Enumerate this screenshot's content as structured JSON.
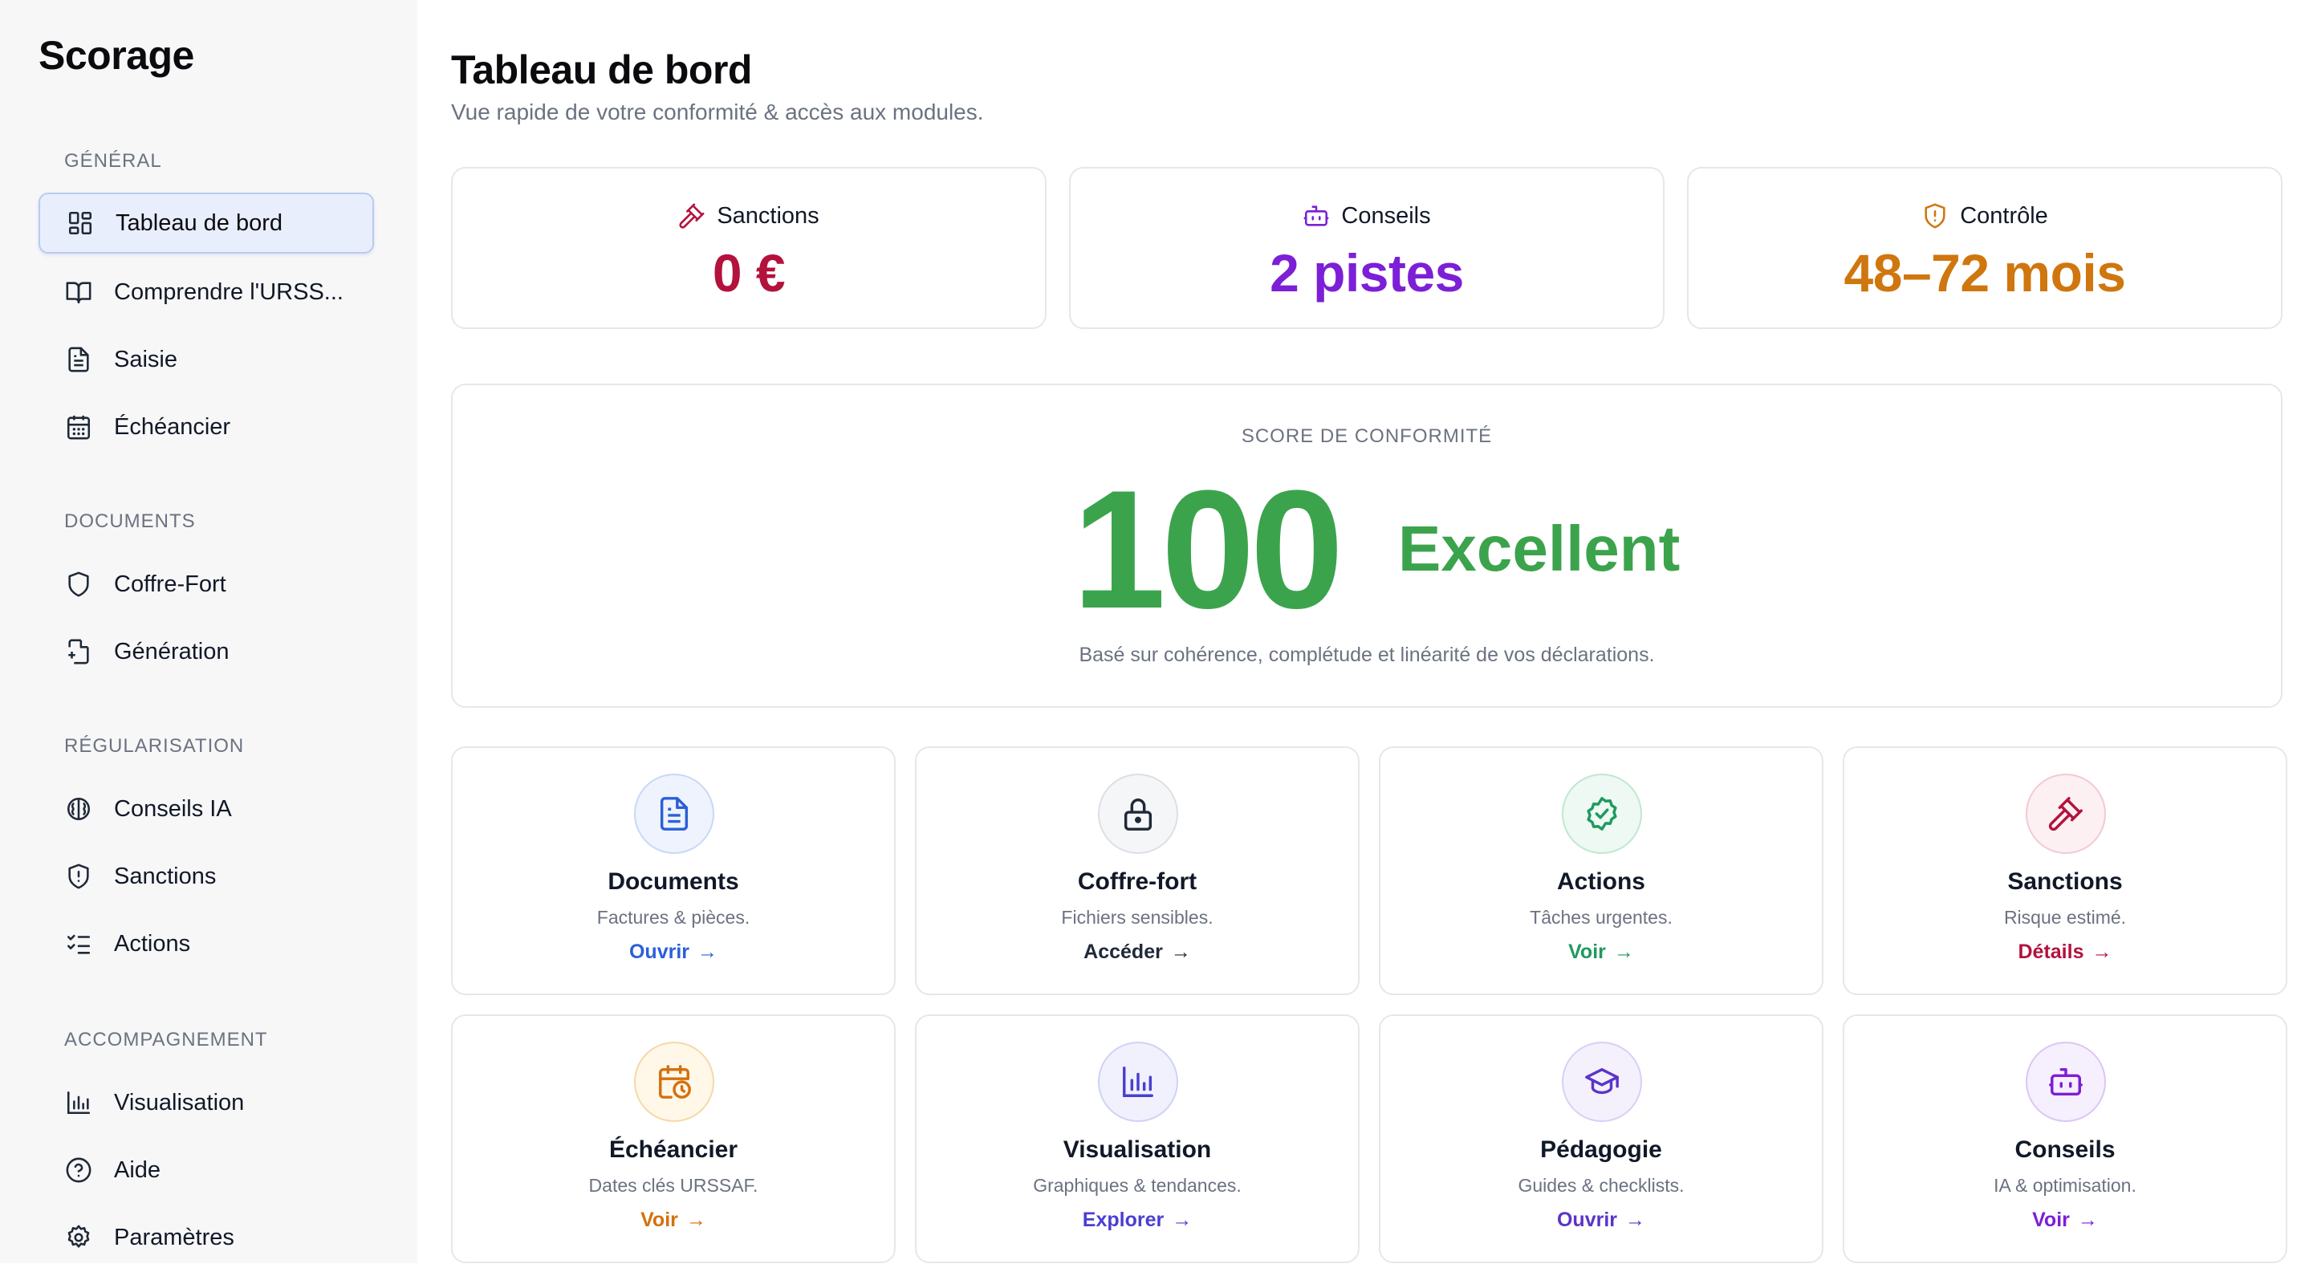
{
  "app": {
    "brand": "Scorage"
  },
  "sidebar": {
    "sections": [
      {
        "label": "GÉNÉRAL",
        "items": [
          {
            "label": "Tableau de bord",
            "icon": "dashboard-grid-icon",
            "active": true
          },
          {
            "label": "Comprendre l'URSS...",
            "icon": "book-icon"
          },
          {
            "label": "Saisie",
            "icon": "document-icon"
          },
          {
            "label": "Échéancier",
            "icon": "calendar-icon"
          }
        ]
      },
      {
        "label": "DOCUMENTS",
        "items": [
          {
            "label": "Coffre-Fort",
            "icon": "shield-icon"
          },
          {
            "label": "Génération",
            "icon": "file-plus-icon"
          }
        ]
      },
      {
        "label": "RÉGULARISATION",
        "items": [
          {
            "label": "Conseils IA",
            "icon": "brain-icon"
          },
          {
            "label": "Sanctions",
            "icon": "shield-alert-icon"
          },
          {
            "label": "Actions",
            "icon": "checklist-icon"
          }
        ]
      },
      {
        "label": "ACCOMPAGNEMENT",
        "items": [
          {
            "label": "Visualisation",
            "icon": "bar-chart-icon"
          },
          {
            "label": "Aide",
            "icon": "help-circle-icon"
          },
          {
            "label": "Paramètres",
            "icon": "gear-icon"
          }
        ]
      }
    ]
  },
  "header": {
    "title": "Tableau de bord",
    "subtitle": "Vue rapide de votre conformité & accès aux modules."
  },
  "stats": [
    {
      "label": "Sanctions",
      "value": "0 €",
      "icon": "gavel-icon",
      "color": "#b3123c"
    },
    {
      "label": "Conseils",
      "value": "2 pistes",
      "icon": "robot-icon",
      "color": "#7c1fd6"
    },
    {
      "label": "Contrôle",
      "value": "48–72 mois",
      "icon": "shield-alert-icon",
      "color": "#cf760e"
    }
  ],
  "score": {
    "caption": "SCORE DE CONFORMITÉ",
    "value": "100",
    "rating": "Excellent",
    "note": "Basé sur cohérence, complétude et linéarité de vos déclarations.",
    "color": "#3ca34d"
  },
  "modules": [
    {
      "title": "Documents",
      "desc": "Factures & pièces.",
      "link": "Ouvrir",
      "icon": "document-icon",
      "color": "#2b5fd9",
      "bg": "#eef3fd",
      "border": "#c9d8f7"
    },
    {
      "title": "Coffre-fort",
      "desc": "Fichiers sensibles.",
      "link": "Accéder",
      "icon": "lock-icon",
      "color": "#1f2937",
      "bg": "#f5f6f8",
      "border": "#dcdfe4"
    },
    {
      "title": "Actions",
      "desc": "Tâches urgentes.",
      "link": "Voir",
      "icon": "badge-check-icon",
      "color": "#1e9a5e",
      "bg": "#edf9f2",
      "border": "#bfe8d1"
    },
    {
      "title": "Sanctions",
      "desc": "Risque estimé.",
      "link": "Détails",
      "icon": "gavel-icon",
      "color": "#b3123c",
      "bg": "#fdf0f2",
      "border": "#f3c9d2"
    },
    {
      "title": "Échéancier",
      "desc": "Dates clés URSSAF.",
      "link": "Voir",
      "icon": "calendar-clock-icon",
      "color": "#d4700e",
      "bg": "#fff7e8",
      "border": "#f5d9a8"
    },
    {
      "title": "Visualisation",
      "desc": "Graphiques & tendances.",
      "link": "Explorer",
      "icon": "bar-chart-icon",
      "color": "#4a3fd1",
      "bg": "#f0f1fd",
      "border": "#cfd2f5"
    },
    {
      "title": "Pédagogie",
      "desc": "Guides & checklists.",
      "link": "Ouvrir",
      "icon": "graduation-cap-icon",
      "color": "#5b34c9",
      "bg": "#f4f1fd",
      "border": "#d9cff5"
    },
    {
      "title": "Conseils",
      "desc": "IA & optimisation.",
      "link": "Voir",
      "icon": "robot-icon",
      "color": "#7c1fd6",
      "bg": "#f6effd",
      "border": "#dcc6f5"
    }
  ]
}
